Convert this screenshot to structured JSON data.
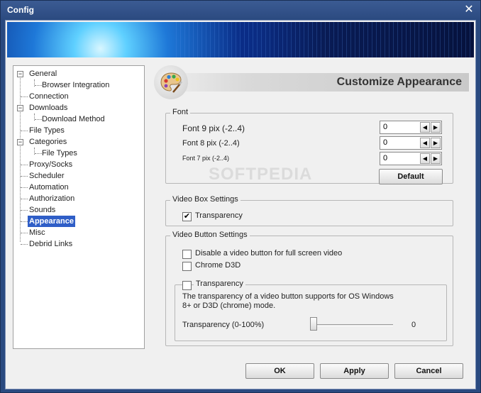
{
  "window": {
    "title": "Config"
  },
  "tree": {
    "items": [
      {
        "label": "General"
      },
      {
        "label": "Browser Integration"
      },
      {
        "label": "Connection"
      },
      {
        "label": "Downloads"
      },
      {
        "label": "Download Method"
      },
      {
        "label": "File Types"
      },
      {
        "label": "Categories"
      },
      {
        "label": "File Types"
      },
      {
        "label": "Proxy/Socks"
      },
      {
        "label": "Scheduler"
      },
      {
        "label": "Automation"
      },
      {
        "label": "Authorization"
      },
      {
        "label": "Sounds"
      },
      {
        "label": "Appearance",
        "selected": true
      },
      {
        "label": "Misc"
      },
      {
        "label": "Debrid Links"
      }
    ]
  },
  "page": {
    "title": "Customize Appearance"
  },
  "font_group": {
    "legend": "Font",
    "rows": [
      {
        "label": "Font 9 pix (-2..4)",
        "value": "0"
      },
      {
        "label": "Font 8 pix (-2..4)",
        "value": "0"
      },
      {
        "label": "Font 7 pix (-2..4)",
        "value": "0"
      }
    ],
    "default_label": "Default"
  },
  "video_box": {
    "legend": "Video Box Settings",
    "transparency_label": "Transparency",
    "transparency_checked": true
  },
  "video_button": {
    "legend": "Video Button Settings",
    "disable_label": "Disable a video button for full screen video",
    "chrome_label": "Chrome D3D",
    "transparency_label": "Transparency",
    "note": "The transparency of a video button supports for OS Windows 8+ or D3D (chrome) mode.",
    "slider_label": "Transparency (0-100%)",
    "slider_value": "0",
    "slider_fraction": 0
  },
  "buttons": {
    "ok": "OK",
    "apply": "Apply",
    "cancel": "Cancel"
  },
  "watermark": "SOFTPEDIA"
}
